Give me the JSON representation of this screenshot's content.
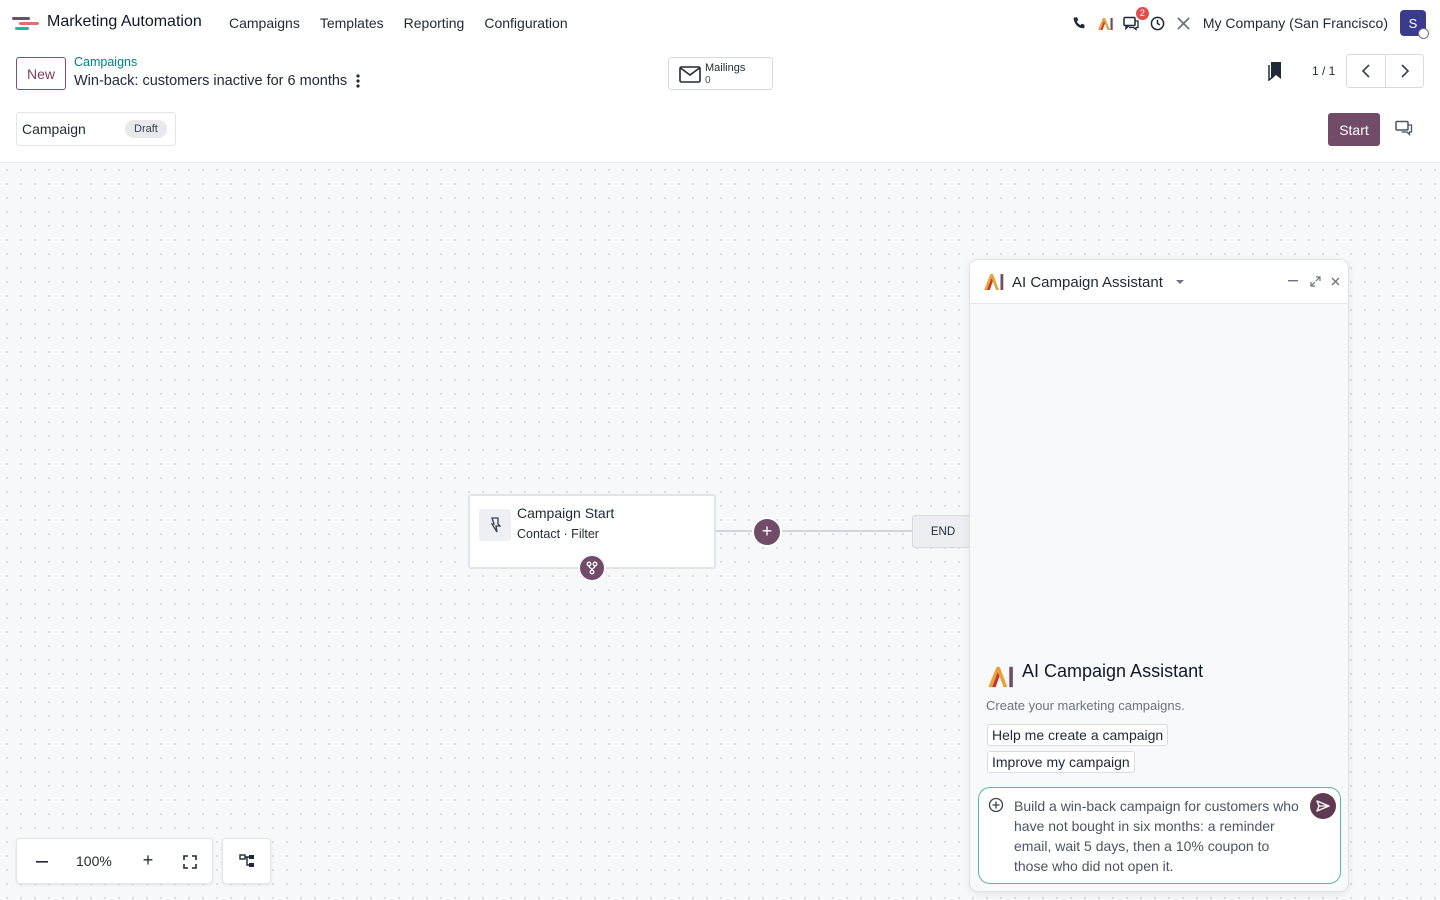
{
  "navbar": {
    "app_name": "Marketing Automation",
    "menu": [
      "Campaigns",
      "Templates",
      "Reporting",
      "Configuration"
    ],
    "notifications_count": "2",
    "company": "My Company (San Francisco)",
    "user_initial": "S"
  },
  "control_panel": {
    "new_label": "New",
    "breadcrumb": "Campaigns",
    "record_title": "Win-back: customers inactive for 6 months",
    "mailings_label": "Mailings",
    "mailings_count": "0",
    "pager": "1 / 1",
    "status_name": "Campaign",
    "status_badge": "Draft",
    "start_label": "Start"
  },
  "canvas": {
    "start_node_title": "Campaign Start",
    "start_node_subtitle": "Contact · Filter",
    "end_label": "END",
    "zoom_value": "100%"
  },
  "ai_panel": {
    "header_title": "AI Campaign Assistant",
    "welcome_title": "AI Campaign Assistant",
    "welcome_subtitle": "Create your marketing campaigns.",
    "suggestions": [
      "Help me create a campaign",
      "Improve my campaign"
    ],
    "input_text": "Build a win-back campaign for customers who have not bought in six months: a reminder email, wait 5 days, then a 10% coupon to those who did not open it."
  },
  "colors": {
    "brand": "#714b67",
    "link": "#017e84",
    "input_focus": "#5bb6a8"
  }
}
